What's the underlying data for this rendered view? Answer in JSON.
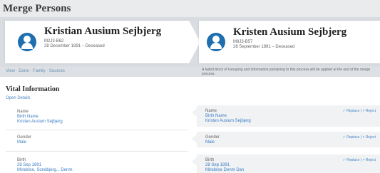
{
  "page": {
    "title": "Merge Persons"
  },
  "left_person": {
    "name": "Kristian Ausium Sejbjerg",
    "id": "M2J3-B62",
    "dates": "28 December 1891 – Deceased"
  },
  "right_person": {
    "name": "Kristen Ausium Sejbjerg",
    "id": "M8J3-B57",
    "dates": "28 September 1891 – Deceased"
  },
  "infobar": {
    "breadcrumb": "View  ·  Done  ·  Family  ·  Sources",
    "note": "A faded block of Grouping and information pertaining to this process will be applied at the end of the merge process."
  },
  "section": {
    "title": "Vital Information",
    "link": "Open Details"
  },
  "fields": [
    {
      "label": "Name",
      "left_sub": "Birth Name",
      "left_value": "Kristen Ausium Sejbjerg",
      "right_sub": "Birth Name",
      "right_value": "Kristen Ausium Sejbjerg",
      "actions": "✓ Replace  |  × Reject"
    },
    {
      "label": "Gender",
      "left_sub": "",
      "left_value": "Male",
      "right_sub": "",
      "right_value": "Male",
      "actions": "✓ Replace  |  × Reject"
    },
    {
      "label": "Birth",
      "left_sub": "28 Sep 1891",
      "left_value": "Mindelse, Sondbjerg... Denm.",
      "right_sub": "28 Sep 1891",
      "right_value": "Mindelse Denm Dan",
      "actions": "✓ Replace  |  × Reject"
    }
  ]
}
